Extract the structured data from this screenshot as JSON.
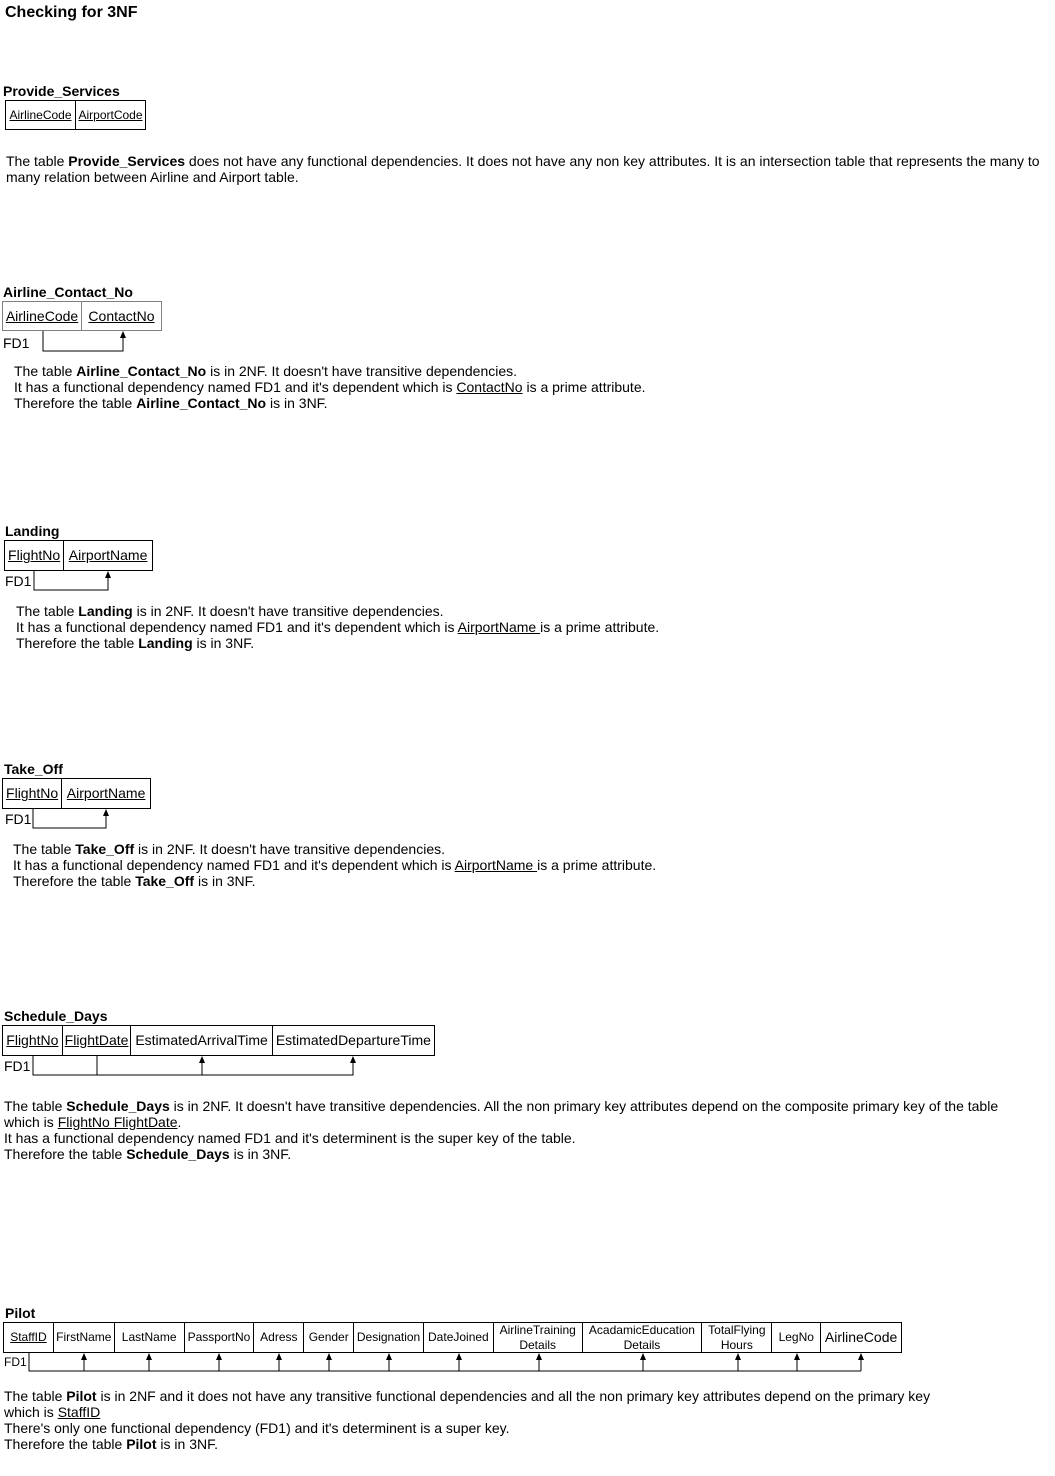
{
  "title": "Checking for 3NF",
  "sections": {
    "provide_services": {
      "name": "Provide_Services",
      "columns": [
        "AirlineCode",
        "AirportCode"
      ],
      "p_pre": "The table ",
      "p_bold": "Provide_Services",
      "p_post": " does not have any functional dependencies. It does not have any non key attributes. It is an intersection table that represents the many to many relation between Airline and Airport table."
    },
    "airline_contact": {
      "name": "Airline_Contact_No",
      "columns": [
        "AirlineCode",
        "ContactNo"
      ],
      "fd": "FD1",
      "l1_pre": "The table ",
      "l1_bold": "Airline_Contact_No",
      "l1_post": " is in 2NF. It doesn't have transitive dependencies.",
      "l2_pre": "It has a functional dependency named FD1 and it's dependent which is ",
      "l2_u": "ContactNo",
      "l2_post": " is a prime attribute.",
      "l3_pre": "Therefore the table ",
      "l3_bold": "Airline_Contact_No",
      "l3_post": " is in 3NF."
    },
    "landing": {
      "name": "Landing",
      "columns": [
        "FlightNo",
        "AirportName"
      ],
      "fd": "FD1",
      "l1_pre": "The table ",
      "l1_bold": "Landing",
      "l1_post": " is in 2NF. It doesn't have transitive dependencies.",
      "l2_pre": "It has a functional dependency named FD1 and it's dependent which is ",
      "l2_u": "AirportName ",
      "l2_post": "is a prime attribute.",
      "l3_pre": "Therefore the table ",
      "l3_bold": "Landing",
      "l3_post": " is in 3NF."
    },
    "take_off": {
      "name": "Take_Off",
      "columns": [
        "FlightNo",
        "AirportName"
      ],
      "fd": "FD1",
      "l1_pre": "The table ",
      "l1_bold": "Take_Off",
      "l1_post": " is in 2NF. It doesn't have transitive dependencies.",
      "l2_pre": "It has a functional dependency named FD1 and it's dependent which is ",
      "l2_u": "AirportName ",
      "l2_post": "is a prime attribute.",
      "l3_pre": "Therefore the table ",
      "l3_bold": "Take_Off",
      "l3_post": " is in 3NF."
    },
    "schedule_days": {
      "name": "Schedule_Days",
      "columns": [
        "FlightNo",
        "FlightDate",
        "EstimatedArrivalTime",
        "EstimatedDepartureTime"
      ],
      "fd": "FD1",
      "l1_pre": "The table ",
      "l1_bold": "Schedule_Days",
      "l1_post": " is in 2NF. It doesn't have transitive dependencies. All the non primary key attributes depend on the composite primary key of the table which is ",
      "l1_u": "FlightNo FlightDate",
      "l1_end": ".",
      "l2": "It has a functional dependency named FD1 and it's determinent is the super key of the table.",
      "l3_pre": "Therefore the table ",
      "l3_bold": "Schedule_Days",
      "l3_post": " is in 3NF."
    },
    "pilot": {
      "name": "Pilot",
      "columns": [
        "StaffID",
        "FirstName",
        "LastName",
        "PassportNo",
        "Adress",
        "Gender",
        "Designation",
        "DateJoined",
        "AirlineTraining Details",
        "AcadamicEducation Details",
        "TotalFlying Hours",
        "LegNo",
        "AirlineCode"
      ],
      "fd": "FD1",
      "l1_pre": "The table ",
      "l1_bold": "Pilot",
      "l1_post": " is in 2NF and it does not have any transitive functional dependencies and all the non primary key attributes depend on the primary key",
      "l1b_pre": "which is ",
      "l1b_u": "StaffID",
      "l2": "There's only one functional dependency (FD1) and it's determinent is a super key.",
      "l3_pre": "Therefore the table ",
      "l3_bold": "Pilot",
      "l3_post": " is in 3NF."
    }
  }
}
